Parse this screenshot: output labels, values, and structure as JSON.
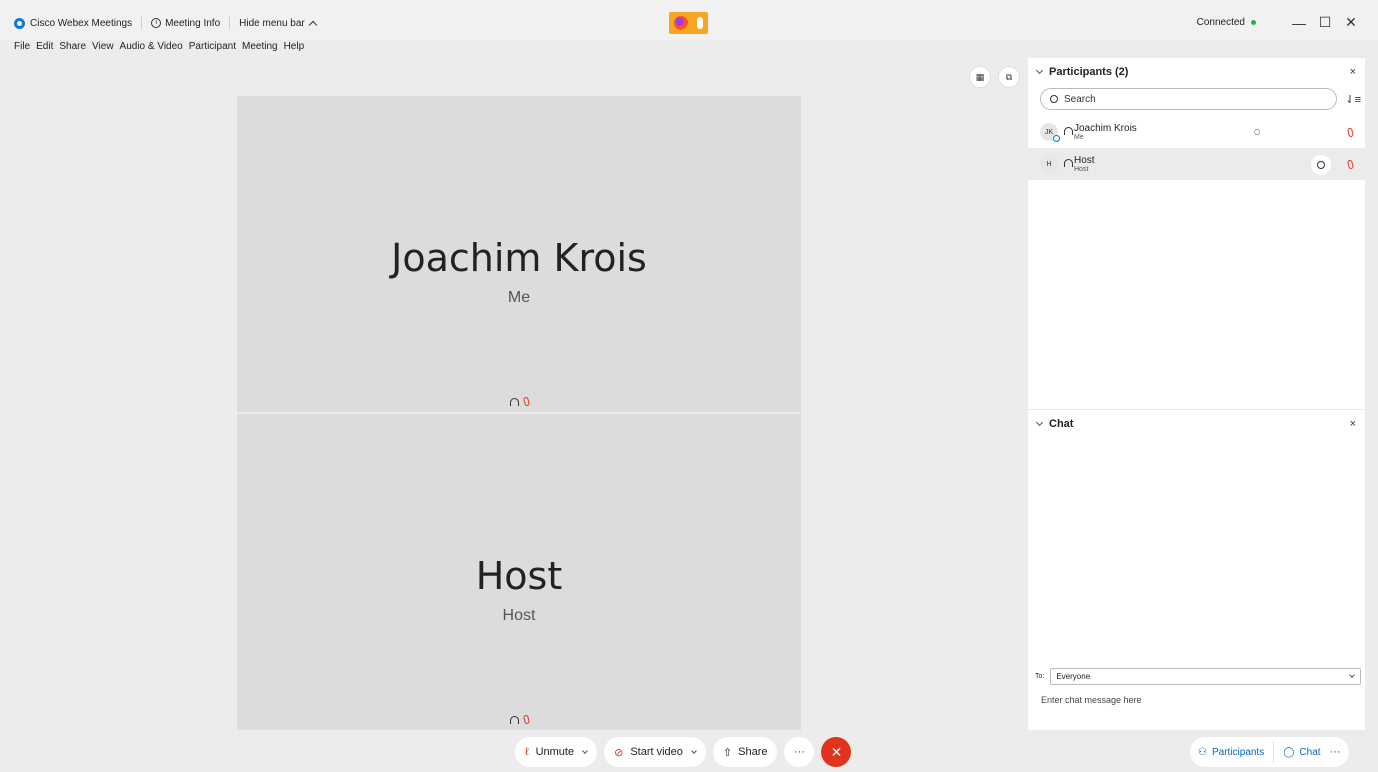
{
  "titlebar": {
    "app_name": "Cisco Webex Meetings",
    "meeting_info": "Meeting Info",
    "hide_menu": "Hide menu bar",
    "status": "Connected",
    "minimize": "—",
    "maximize": "☐",
    "close": "✕"
  },
  "menu": [
    "File",
    "Edit",
    "Share",
    "View",
    "Audio & Video",
    "Participant",
    "Meeting",
    "Help"
  ],
  "tiles": [
    {
      "name": "Joachim Krois",
      "role": "Me"
    },
    {
      "name": "Host",
      "role": "Host"
    }
  ],
  "participants_panel": {
    "title": "Participants (2)",
    "close": "×",
    "search_placeholder": "Search",
    "participants": [
      {
        "initials": "JK",
        "name": "Joachim Krois",
        "sub": "Me"
      },
      {
        "initials": "H",
        "name": "Host",
        "sub": "Host"
      }
    ]
  },
  "chat_panel": {
    "title": "Chat",
    "close": "×",
    "to_label": "To:",
    "to_value": "Everyone",
    "input_placeholder": "Enter chat message here"
  },
  "controls": {
    "unmute": "Unmute",
    "start_video": "Start video",
    "share": "Share",
    "more": "···",
    "end": "✕"
  },
  "right_controls": {
    "participants": "Participants",
    "chat": "Chat",
    "more": "···"
  },
  "colors": {
    "accent": "#0a64c8",
    "end_red": "#e1331e",
    "mute_red": "#e0341e",
    "connected_green": "#2ab04a"
  }
}
